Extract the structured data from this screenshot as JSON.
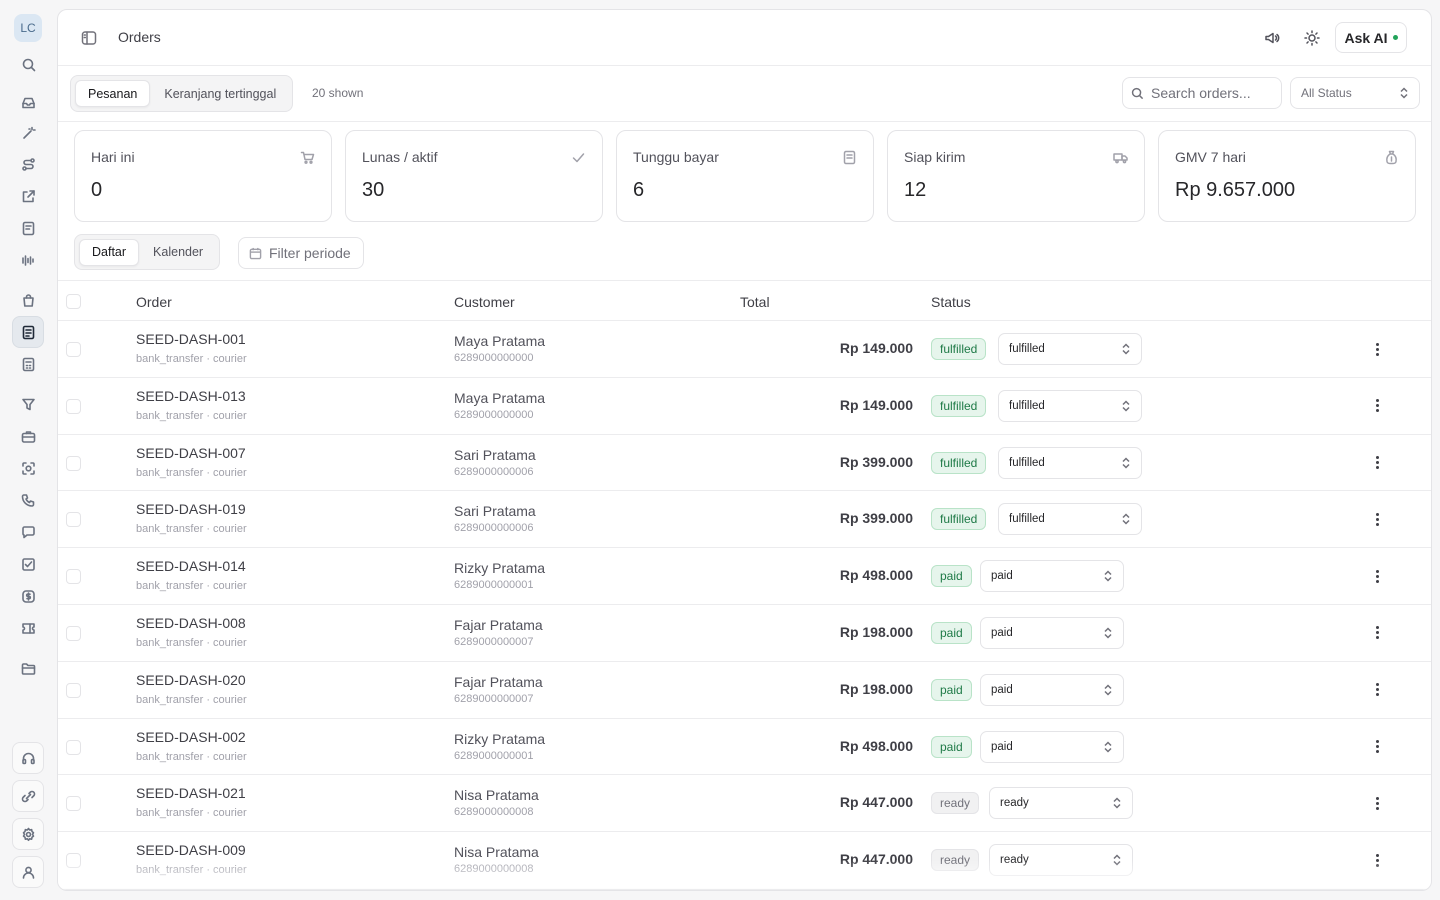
{
  "sidebar": {
    "avatar": "LC",
    "icons": [
      "search-icon",
      "inbox-icon",
      "magic-wand-icon",
      "route-icon",
      "share-icon",
      "note-icon",
      "audio-wave-icon",
      "bag-icon",
      "orders-icon",
      "calculator-icon",
      "filter-icon",
      "briefcase-icon",
      "scan-face-icon",
      "phone-icon",
      "chat-icon",
      "checklist-icon",
      "dollar-icon",
      "ticket-icon",
      "folder-icon"
    ],
    "bottom_icons": [
      "headset-icon",
      "link-icon",
      "settings-icon",
      "user-icon"
    ],
    "active": "orders-icon"
  },
  "header": {
    "title": "Orders",
    "ask_ai": "Ask AI",
    "ask_ai_dot_color": "#22a35a"
  },
  "toolbar": {
    "tabs": [
      "Pesanan",
      "Keranjang tertinggal"
    ],
    "active_tab": 0,
    "shown": "20 shown",
    "search_placeholder": "Search orders...",
    "status_filter": "All Status"
  },
  "stats": [
    {
      "label": "Hari ini",
      "value": "0",
      "icon": "cart-icon"
    },
    {
      "label": "Lunas / aktif",
      "value": "30",
      "icon": "check-icon"
    },
    {
      "label": "Tunggu bayar",
      "value": "6",
      "icon": "receipt-icon"
    },
    {
      "label": "Siap kirim",
      "value": "12",
      "icon": "truck-icon"
    },
    {
      "label": "GMV 7 hari",
      "value": "Rp 9.657.000",
      "icon": "money-bag-icon"
    }
  ],
  "view": {
    "tabs": [
      "Daftar",
      "Kalender"
    ],
    "active_tab": 0,
    "period_filter": "Filter periode"
  },
  "table": {
    "columns": [
      "Order",
      "Customer",
      "Total",
      "Status"
    ],
    "rows": [
      {
        "order": "SEED-DASH-001",
        "meta": "bank_transfer · courier",
        "customer": "Maya Pratama",
        "phone": "6289000000000",
        "total": "Rp 149.000",
        "status": "fulfilled",
        "select": "fulfilled"
      },
      {
        "order": "SEED-DASH-013",
        "meta": "bank_transfer · courier",
        "customer": "Maya Pratama",
        "phone": "6289000000000",
        "total": "Rp 149.000",
        "status": "fulfilled",
        "select": "fulfilled"
      },
      {
        "order": "SEED-DASH-007",
        "meta": "bank_transfer · courier",
        "customer": "Sari Pratama",
        "phone": "6289000000006",
        "total": "Rp 399.000",
        "status": "fulfilled",
        "select": "fulfilled"
      },
      {
        "order": "SEED-DASH-019",
        "meta": "bank_transfer · courier",
        "customer": "Sari Pratama",
        "phone": "6289000000006",
        "total": "Rp 399.000",
        "status": "fulfilled",
        "select": "fulfilled"
      },
      {
        "order": "SEED-DASH-014",
        "meta": "bank_transfer · courier",
        "customer": "Rizky Pratama",
        "phone": "6289000000001",
        "total": "Rp 498.000",
        "status": "paid",
        "select": "paid"
      },
      {
        "order": "SEED-DASH-008",
        "meta": "bank_transfer · courier",
        "customer": "Fajar Pratama",
        "phone": "6289000000007",
        "total": "Rp 198.000",
        "status": "paid",
        "select": "paid"
      },
      {
        "order": "SEED-DASH-020",
        "meta": "bank_transfer · courier",
        "customer": "Fajar Pratama",
        "phone": "6289000000007",
        "total": "Rp 198.000",
        "status": "paid",
        "select": "paid"
      },
      {
        "order": "SEED-DASH-002",
        "meta": "bank_transfer · courier",
        "customer": "Rizky Pratama",
        "phone": "6289000000001",
        "total": "Rp 498.000",
        "status": "paid",
        "select": "paid"
      },
      {
        "order": "SEED-DASH-021",
        "meta": "bank_transfer · courier",
        "customer": "Nisa Pratama",
        "phone": "6289000000008",
        "total": "Rp 447.000",
        "status": "ready",
        "select": "ready"
      },
      {
        "order": "SEED-DASH-009",
        "meta": "bank_transfer · courier",
        "customer": "Nisa Pratama",
        "phone": "6289000000008",
        "total": "Rp 447.000",
        "status": "ready",
        "select": "ready"
      }
    ]
  }
}
